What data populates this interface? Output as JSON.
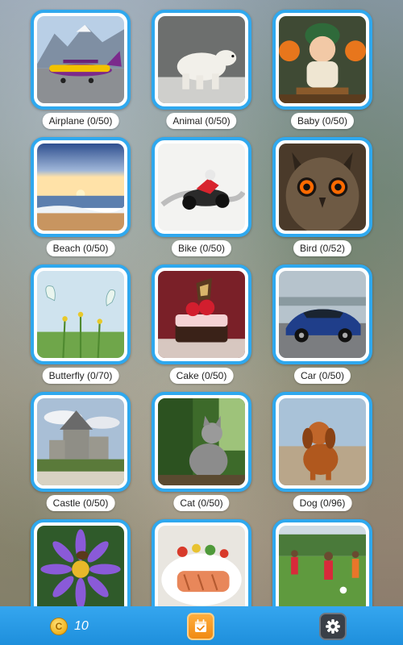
{
  "categories": [
    {
      "label": "Airplane (0/50)",
      "image": "airplane"
    },
    {
      "label": "Animal (0/50)",
      "image": "polar-bear"
    },
    {
      "label": "Baby (0/50)",
      "image": "baby"
    },
    {
      "label": "Beach (0/50)",
      "image": "beach"
    },
    {
      "label": "Bike (0/50)",
      "image": "bike"
    },
    {
      "label": "Bird (0/52)",
      "image": "owl"
    },
    {
      "label": "Butterfly (0/70)",
      "image": "butterfly"
    },
    {
      "label": "Cake (0/50)",
      "image": "cake"
    },
    {
      "label": "Car (0/50)",
      "image": "car"
    },
    {
      "label": "Castle (0/50)",
      "image": "castle"
    },
    {
      "label": "Cat (0/50)",
      "image": "cat"
    },
    {
      "label": "Dog (0/96)",
      "image": "dog"
    },
    {
      "label": "",
      "image": "flower"
    },
    {
      "label": "",
      "image": "food"
    },
    {
      "label": "",
      "image": "soccer"
    }
  ],
  "bottom_bar": {
    "coin_symbol": "C",
    "coin_count": "10",
    "daily_icon": "calendar-check-icon",
    "settings_icon": "gear-icon"
  },
  "colors": {
    "card_border": "#2fa8ee",
    "bottom_bar": "#1e8fdc",
    "daily_button": "#f08a12",
    "settings_button": "#3a3f47"
  }
}
